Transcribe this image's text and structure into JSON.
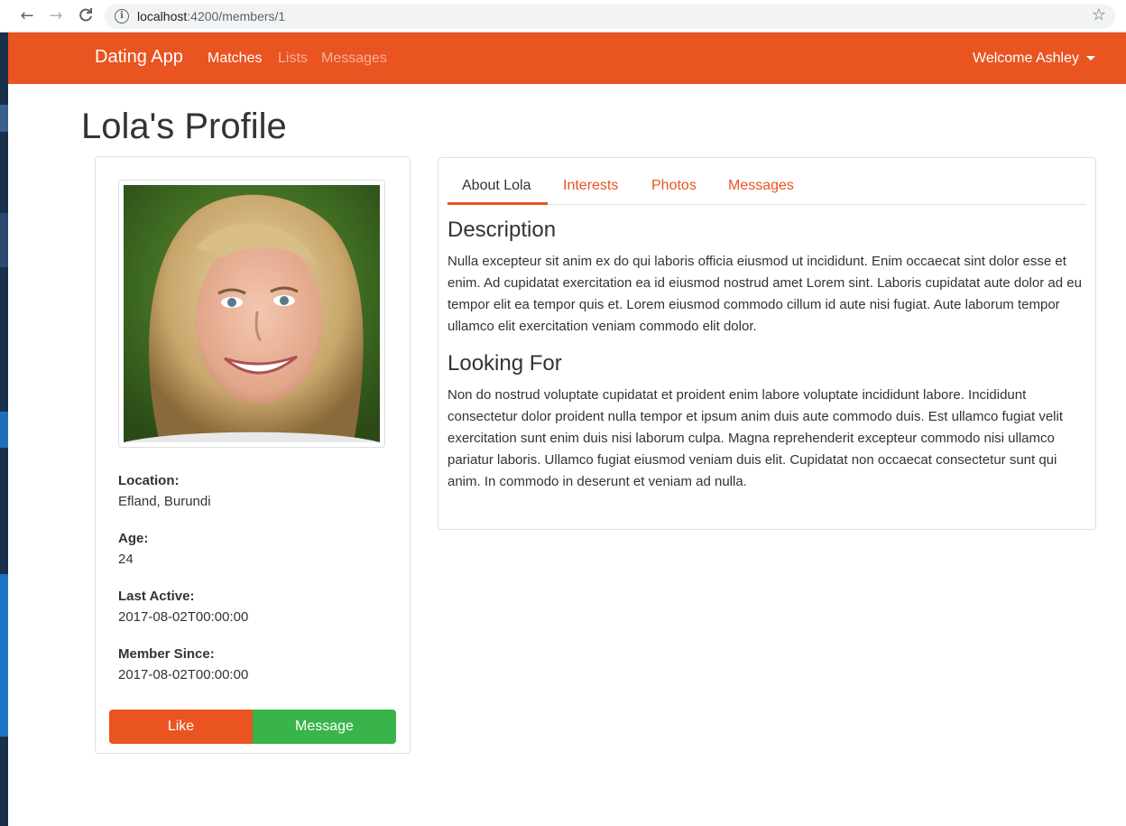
{
  "browser": {
    "url_host": "localhost",
    "url_path": ":4200/members/1"
  },
  "navbar": {
    "brand": "Dating App",
    "links": [
      {
        "label": "Matches"
      },
      {
        "label": "Lists"
      },
      {
        "label": "Messages"
      }
    ],
    "welcome": "Welcome Ashley"
  },
  "page": {
    "title": "Lola's Profile"
  },
  "profile": {
    "photo_alt": "profile photo",
    "fields": [
      {
        "label": "Location:",
        "value": "Efland, Burundi"
      },
      {
        "label": "Age:",
        "value": "24"
      },
      {
        "label": "Last Active:",
        "value": "2017-08-02T00:00:00"
      },
      {
        "label": "Member Since:",
        "value": "2017-08-02T00:00:00"
      }
    ],
    "like_label": "Like",
    "message_label": "Message"
  },
  "tabs": [
    {
      "label": "About Lola"
    },
    {
      "label": "Interests"
    },
    {
      "label": "Photos"
    },
    {
      "label": "Messages"
    }
  ],
  "about": {
    "description_heading": "Description",
    "description_text": "Nulla excepteur sit anim ex do qui laboris officia eiusmod ut incididunt. Enim occaecat sint dolor esse et enim. Ad cupidatat exercitation ea id eiusmod nostrud amet Lorem sint. Laboris cupidatat aute dolor ad eu tempor elit ea tempor quis et. Lorem eiusmod commodo cillum id aute nisi fugiat. Aute laborum tempor ullamco elit exercitation veniam commodo elit dolor.",
    "looking_heading": "Looking For",
    "looking_text": "Non do nostrud voluptate cupidatat et proident enim labore voluptate incididunt labore. Incididunt consectetur dolor proident nulla tempor et ipsum anim duis aute commodo duis. Est ullamco fugiat velit exercitation sunt enim duis nisi laborum culpa. Magna reprehenderit excepteur commodo nisi ullamco pariatur laboris. Ullamco fugiat eiusmod veniam duis elit. Cupidatat non occaecat consectetur sunt qui anim. In commodo in deserunt et veniam ad nulla."
  },
  "colors": {
    "brand": "#e95420",
    "success": "#38b44a"
  }
}
